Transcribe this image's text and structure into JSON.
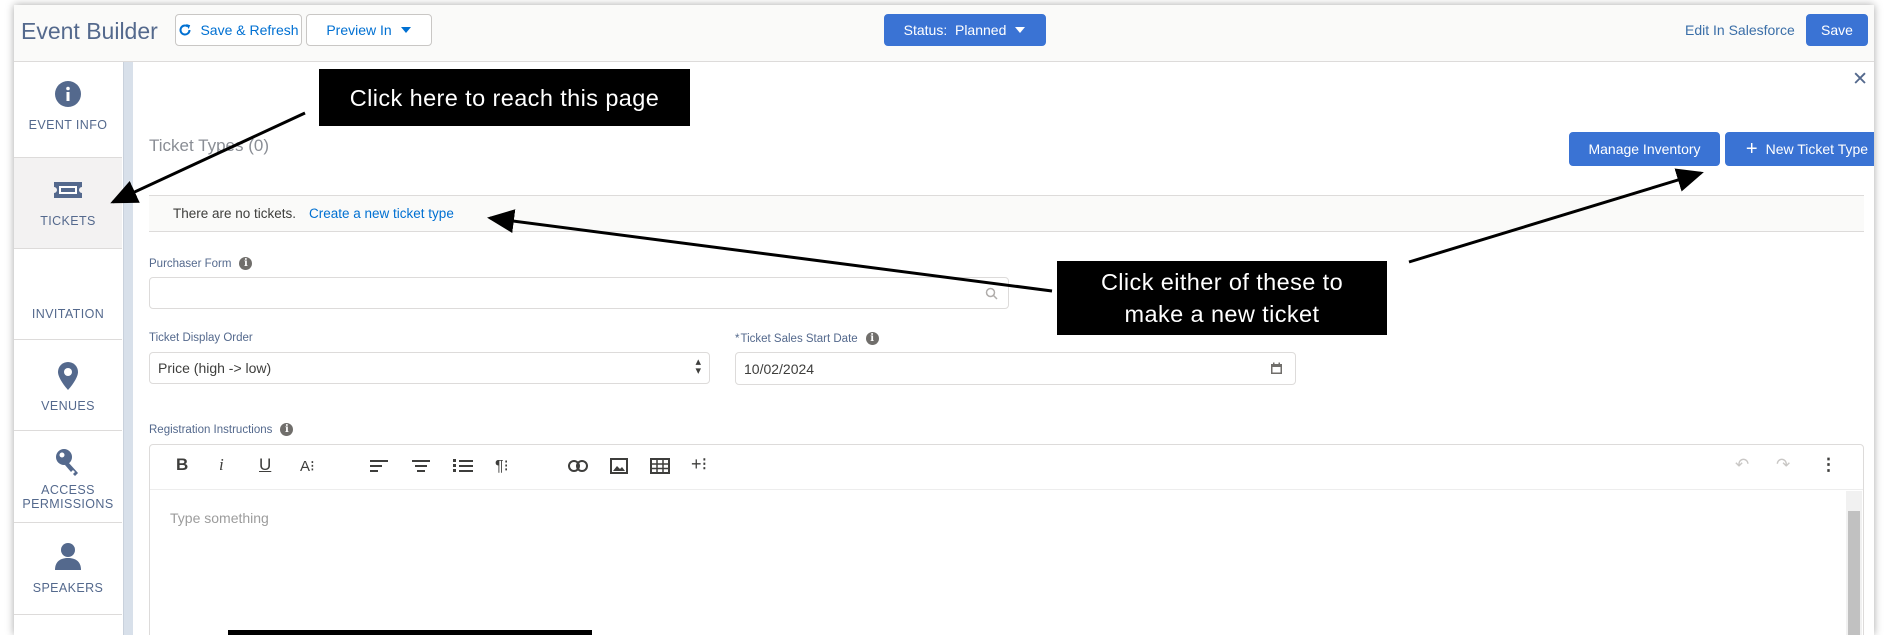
{
  "header": {
    "app_title": "Event Builder",
    "save_refresh_label": "Save & Refresh",
    "preview_label": "Preview In",
    "status_label": "Status:  Planned",
    "edit_salesforce_label": "Edit In Salesforce",
    "save_label": "Save"
  },
  "sidebar": {
    "items": [
      {
        "label": "EVENT INFO",
        "icon": "info-icon"
      },
      {
        "label": "TICKETS",
        "icon": "ticket-icon"
      },
      {
        "label": "INVITATION",
        "icon": ""
      },
      {
        "label": "VENUES",
        "icon": "location-pin-icon"
      },
      {
        "label": "ACCESS",
        "label2": "PERMISSIONS",
        "icon": "key-icon"
      },
      {
        "label": "SPEAKERS",
        "icon": "person-icon"
      }
    ]
  },
  "tickets": {
    "section_title": "Ticket Types (0)",
    "manage_inventory_label": "Manage Inventory",
    "new_ticket_type_label": "New Ticket Type",
    "empty_text": "There are no tickets.",
    "create_link": "Create a new ticket type"
  },
  "form": {
    "purchaser_form_label": "Purchaser Form",
    "purchaser_form_value": "",
    "display_order_label": "Ticket Display Order",
    "display_order_value": "Price (high -> low)",
    "sales_start_required": "*",
    "sales_start_label": "Ticket Sales Start Date",
    "sales_start_value": "10/02/2024",
    "registration_label": "Registration Instructions",
    "editor_placeholder": "Type something"
  },
  "annotations": {
    "callout_1": "Click here to reach this page",
    "callout_2_line1": "Click either of these to",
    "callout_2_line2": "make a new ticket"
  },
  "colors": {
    "brand": "#3a73d4",
    "link": "#0070d2",
    "callout_bg": "#000000"
  }
}
